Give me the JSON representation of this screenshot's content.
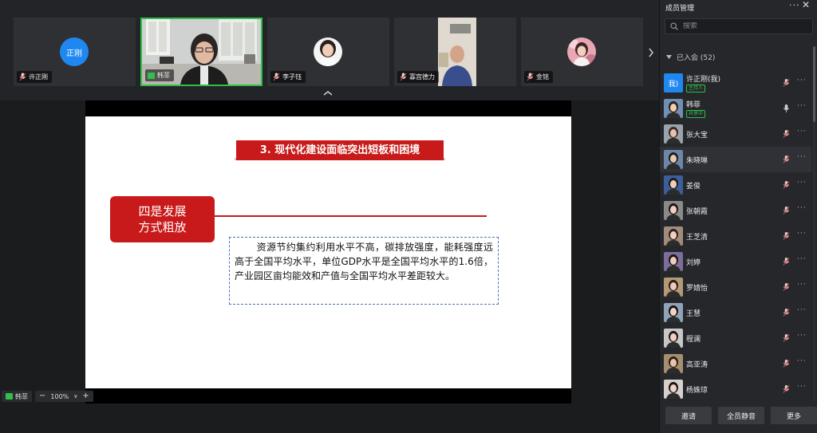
{
  "video_strip": {
    "tiles": [
      {
        "name": "许正刚",
        "avatar_text": "正刚",
        "kind": "avatar"
      },
      {
        "name": "韩菲",
        "kind": "video",
        "active": true
      },
      {
        "name": "李子钰",
        "kind": "photo"
      },
      {
        "name": "寡宫德力",
        "kind": "video"
      },
      {
        "name": "金铭",
        "kind": "photo"
      }
    ]
  },
  "slide": {
    "title": "3. 现代化建设面临突出短板和困境",
    "box_line1": "四是发展",
    "box_line2": "方式粗放",
    "body": "资源节约集约利用水平不高，碳排放强度，能耗强度远高于全国平均水平，单位GDP水平是全国平均水平的1.6倍，产业园区亩均能效和产值与全国平均水平差距较大。"
  },
  "share_controls": {
    "presenter": "韩菲",
    "zoom": "100%",
    "zoom_minus": "−",
    "zoom_plus": "+",
    "zoom_caret": "∨"
  },
  "members_panel": {
    "title": "成员管理",
    "more": "···",
    "close": "✕",
    "search_placeholder": "搜索",
    "group_label": "已入会 (52)",
    "members": [
      {
        "name": "许正刚(我)",
        "role": "主持人",
        "avatar_text": "我)",
        "avatar_kind": "text",
        "mic": "muted"
      },
      {
        "name": "韩菲",
        "role": "共享中",
        "avatar_kind": "photo",
        "mic": "on"
      },
      {
        "name": "张大宝",
        "avatar_kind": "photo",
        "mic": "muted"
      },
      {
        "name": "朱晓琳",
        "avatar_kind": "photo",
        "mic": "muted"
      },
      {
        "name": "姜俊",
        "avatar_kind": "photo",
        "mic": "muted"
      },
      {
        "name": "张朝霞",
        "avatar_kind": "photo",
        "mic": "muted"
      },
      {
        "name": "王芝清",
        "avatar_kind": "photo",
        "mic": "muted"
      },
      {
        "name": "刘婷",
        "avatar_kind": "photo",
        "mic": "muted"
      },
      {
        "name": "罗婧怡",
        "avatar_kind": "photo",
        "mic": "muted"
      },
      {
        "name": "王慧",
        "avatar_kind": "photo",
        "mic": "muted"
      },
      {
        "name": "程澜",
        "avatar_kind": "photo",
        "mic": "muted"
      },
      {
        "name": "高亚涛",
        "avatar_kind": "photo",
        "mic": "muted"
      },
      {
        "name": "杨姝琼",
        "avatar_kind": "photo",
        "mic": "muted"
      }
    ],
    "row_more": "···",
    "footer": {
      "invite": "邀请",
      "mute_all": "全员静音",
      "more": "更多"
    }
  },
  "colors": {
    "accent_green": "#2fbf4a",
    "avatar_blue": "#1e88f0",
    "slide_red": "#c81a1a"
  }
}
